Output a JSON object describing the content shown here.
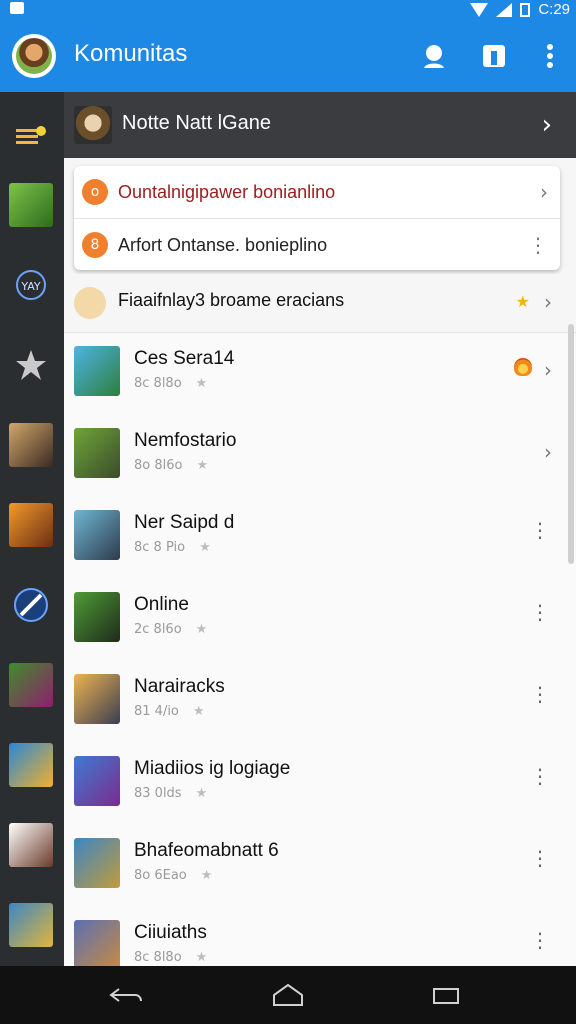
{
  "status": {
    "time": "C:29"
  },
  "appbar": {
    "title": "Komunitas"
  },
  "header": {
    "text": "Notte Natt lGane",
    "chevron": "›"
  },
  "card": [
    {
      "text": "Ountalnigipawer bonianlino",
      "badge": "o",
      "trail": "›",
      "color": "#9b1c1c",
      "badge_color": "#f07f2e"
    },
    {
      "text": "Arfort Ontanse. bonieplino",
      "badge": "8",
      "trail": "⋮",
      "color": "#222222",
      "badge_color": "#f07f2e"
    }
  ],
  "promo": {
    "text": "Fiaaifnlay3 broame eracians",
    "star": "★",
    "trail": "›"
  },
  "list": [
    {
      "name": "Ces Sera14",
      "meta": "8c 8l8o",
      "trail": "›",
      "trail_icon": "flame-icon",
      "thumb_colors": [
        "#4fb3e6",
        "#2c7f3b"
      ]
    },
    {
      "name": "Nemfostario",
      "meta": "8o 8l6o",
      "trail": "›",
      "thumb_colors": [
        "#6ea53a",
        "#3b4c2a"
      ]
    },
    {
      "name": "Ner Saipd d",
      "meta": "8c 8 Pio",
      "trail": "⋮",
      "thumb_colors": [
        "#6fb6d6",
        "#2d3b4b"
      ]
    },
    {
      "name": "Online",
      "meta": "2c 8l6o",
      "trail": "⋮",
      "thumb_colors": [
        "#4f9c37",
        "#1f2a1a"
      ]
    },
    {
      "name": "Narairacks",
      "meta": "81 4/io",
      "trail": "⋮",
      "thumb_colors": [
        "#f0b250",
        "#3a3e52"
      ]
    },
    {
      "name": "Miadiios ig logiage",
      "meta": "83 0lds",
      "trail": "⋮",
      "thumb_colors": [
        "#3e7bd1",
        "#7b2b8e"
      ]
    },
    {
      "name": "Bhafeomabnatt 6",
      "meta": "8o 6Eao",
      "trail": "⋮",
      "thumb_colors": [
        "#3b86c6",
        "#c29b3a"
      ]
    },
    {
      "name": "Ciiuiaths",
      "meta": "8c 8l8o",
      "trail": "⋮",
      "thumb_colors": [
        "#5a6fb5",
        "#c98c3f"
      ]
    }
  ],
  "rail": [
    {
      "icon": "menu-icon"
    },
    {
      "icon": "game-thumb"
    },
    {
      "icon": "badge-icon"
    },
    {
      "icon": "star-icon"
    },
    {
      "icon": "game-thumb"
    },
    {
      "icon": "game-thumb"
    },
    {
      "icon": "blade-icon"
    },
    {
      "icon": "game-thumb"
    },
    {
      "icon": "game-thumb"
    },
    {
      "icon": "game-thumb"
    },
    {
      "icon": "game-thumb"
    }
  ]
}
